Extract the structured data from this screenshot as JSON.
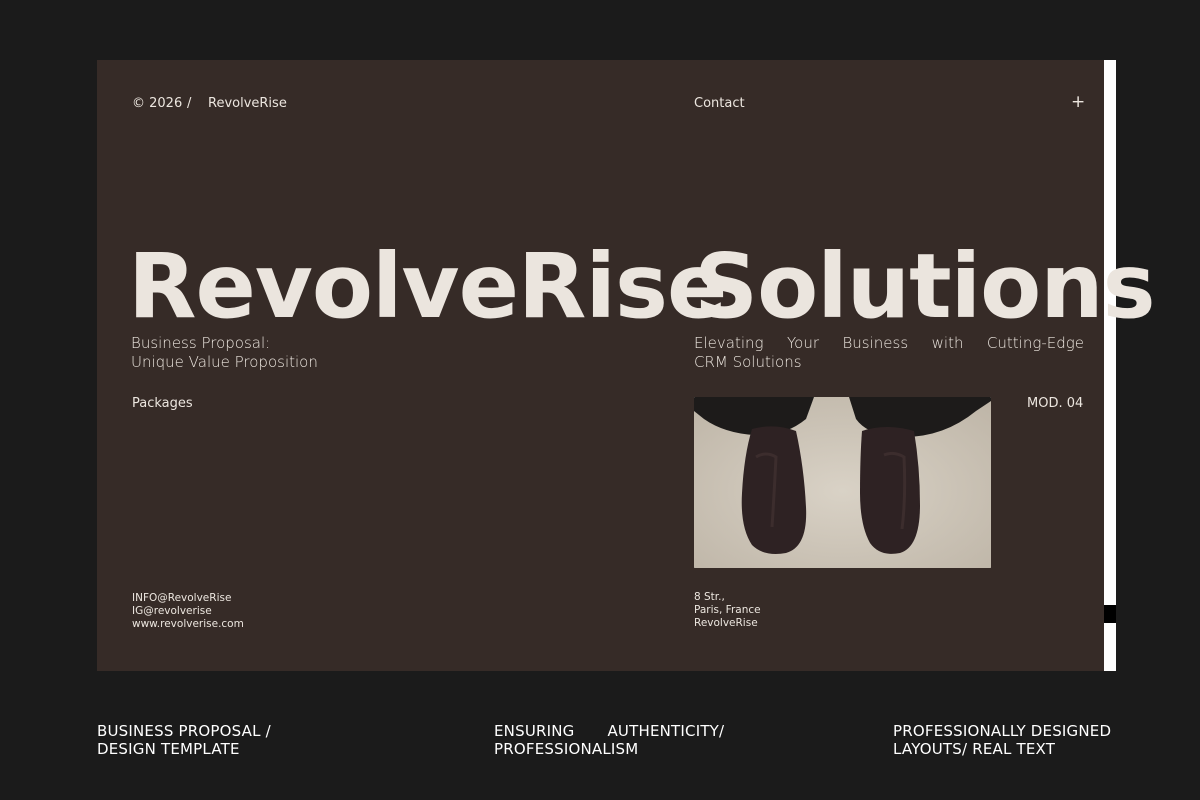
{
  "header": {
    "copyright": "© 2026",
    "separator": "/",
    "brand": "RevolveRise",
    "contact": "Contact",
    "plus": "+"
  },
  "hero": {
    "word1": "RevolveRise",
    "word2": "Solutions"
  },
  "left": {
    "subtitle_line1": "Business Proposal:",
    "subtitle_line2": "Unique Value Proposition",
    "packages": "Packages",
    "info_email": "INFO@RevolveRise",
    "ig": "IG@revolverise",
    "website": "www.revolverise.com"
  },
  "right": {
    "tagline_line1": "Elevating Your Business with Cutting-Edge",
    "tagline_line2": "CRM Solutions",
    "mod": "MOD. 04",
    "address_line1": "8 Str.,",
    "address_line2": "Paris, France",
    "address_line3": "RevolveRise"
  },
  "captions": [
    {
      "line1": "BUSINESS PROPOSAL /",
      "line2": "DESIGN TEMPLATE"
    },
    {
      "line1": "ENSURING AUTHENTICITY/",
      "line2": "PROFESSIONALISM"
    },
    {
      "line1": "PROFESSIONALLY DESIGNED",
      "line2": "LAYOUTS/ REAL TEXT"
    }
  ],
  "colors": {
    "page_bg": "#1b1b1b",
    "slide_bg": "#362b27",
    "text": "#ece6df"
  }
}
